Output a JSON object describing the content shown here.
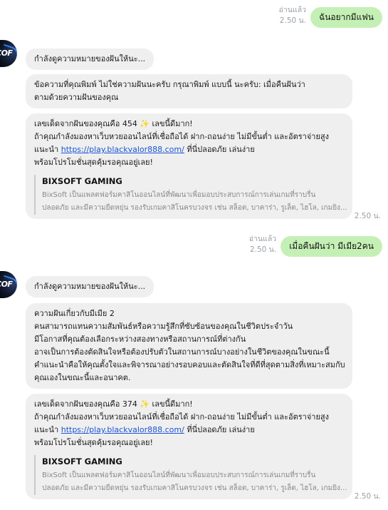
{
  "messages": {
    "out1": {
      "read_label": "อ่านแล้ว",
      "time": "2.50 น.",
      "text": "ฉันอยากมีแฟน"
    },
    "status1": {
      "text": "กำลังดูความหมายของฝันให้นะ..."
    },
    "reply1": {
      "lines": [
        "ข้อความที่คุณพิมพ์ ไม่ใช่ความฝันนะครับ กรุณาพิมพ์ แบบนี้ นะครับ: เมื่อคืนฝันว่า",
        "ตามด้วยความฝันของคุณ"
      ]
    },
    "promo1": {
      "line1": "เลขเด็ดจากฝันของคุณคือ 454 ✨ เลขนี้ดีมาก!",
      "line2": "ถ้าคุณกำลังมองหาเว็บหวยออนไลน์ที่เชื่อถือได้ ฝาก-ถอนง่าย ไม่มีขั้นต่ำ และอัตราจ่ายสูง",
      "line3_prefix": "แนะนำ ",
      "link": "https://play.blackvalor888.com/",
      "line3_suffix": " ที่นี่ปลอดภัย เล่นง่าย",
      "line4": "พร้อมโปรโมชั่นสุดคุ้มรอคุณอยู่เลย!",
      "preview_title": "BIXSOFT GAMING",
      "preview_line1": "BixSoft เป็นแพลตฟอร์มคาสิโนออนไลน์ที่พัฒนาเพื่อมอบประสบการณ์การเล่นเกมที่ราบรื่น",
      "preview_line2": "ปลอดภัย และมีความยืดหยุ่น รองรับเกมคาสิโนครบวงจร เช่น สล็อต, บาคาร่า, รูเล็ต, ไฮโล, เกมยิง...",
      "time": "2.50 น."
    },
    "out2": {
      "read_label": "อ่านแล้ว",
      "time": "2.50 น.",
      "text": "เมื่อคืนฝันว่า มีเมีย2คน"
    },
    "status2": {
      "text": "กำลังดูความหมายของฝันให้นะ..."
    },
    "reply2": {
      "lines": [
        "ความฝันเกี่ยวกับมีเมีย 2",
        "คนสามารถแทนความสัมพันธ์หรือความรู้สึกที่ซับซ้อนของคุณในชีวิตประจำวัน",
        "มีโอกาสที่คุณต้องเลือกระหว่างสองทางหรือสถานการณ์ที่ต่างกัน",
        "อาจเป็นการต้องตัดสินใจหรือต้องปรับตัวในสถานการณ์บางอย่างในชีวิตของคุณในขณะนี้",
        "คำแนะนำคือให้คุณตั้งใจและพิจารณาอย่างรอบคอบและตัดสินใจที่ดีที่สุดตามสิ่งที่เหมาะสมกับ",
        "คุณเองในขณะนี้และอนาคต."
      ]
    },
    "promo2": {
      "line1": "เลขเด็ดจากฝันของคุณคือ 374 ✨ เลขนี้ดีมาก!",
      "line2": "ถ้าคุณกำลังมองหาเว็บหวยออนไลน์ที่เชื่อถือได้ ฝาก-ถอนง่าย ไม่มีขั้นต่ำ และอัตราจ่ายสูง",
      "line3_prefix": "แนะนำ ",
      "link": "https://play.blackvalor888.com/",
      "line3_suffix": " ที่นี่ปลอดภัย เล่นง่าย",
      "line4": "พร้อมโปรโมชั่นสุดคุ้มรอคุณอยู่เลย!",
      "preview_title": "BIXSOFT GAMING",
      "preview_line1": "BixSoft เป็นแพลตฟอร์มคาสิโนออนไลน์ที่พัฒนาเพื่อมอบประสบการณ์การเล่นเกมที่ราบรื่น",
      "preview_line2": "ปลอดภัย และมีความยืดหยุ่น รองรับเกมคาสิโนครบวงจร เช่น สล็อต, บาคาร่า, รูเล็ต, ไฮโล, เกมยิง...",
      "time": "2.50 น."
    }
  },
  "avatar": {
    "icon": "bot-logo-icon",
    "mark_text": "COF"
  },
  "colors": {
    "outgoing_bubble": "#c5f0b5",
    "incoming_bubble": "#efefef",
    "link": "#1a55d6",
    "meta": "#9aa0a6"
  }
}
